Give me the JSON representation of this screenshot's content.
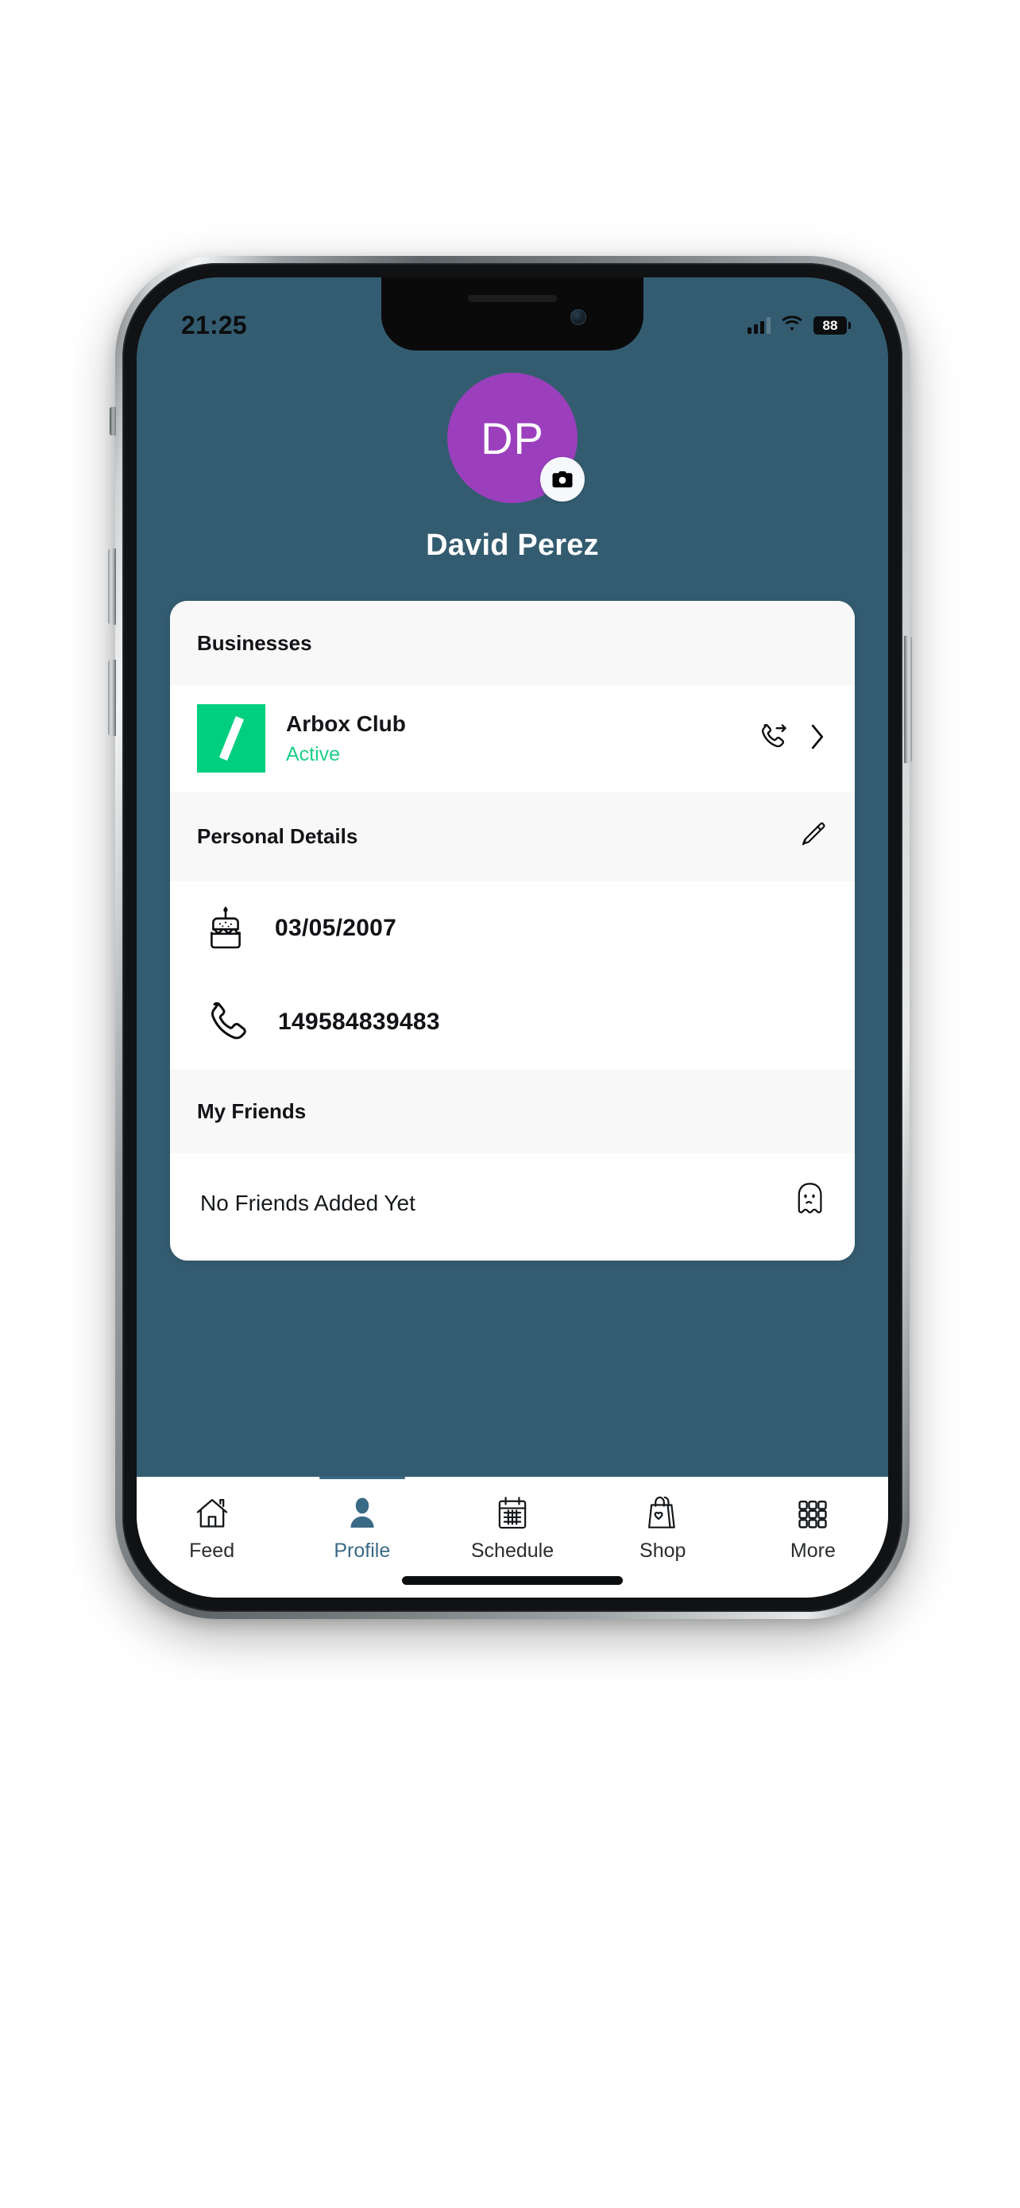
{
  "status_bar": {
    "time": "21:25",
    "battery_level": "88",
    "signal_icon": "cellular-signal-icon",
    "wifi_icon": "wifi-icon",
    "battery_icon": "battery-icon"
  },
  "profile": {
    "initials": "DP",
    "name": "David Perez",
    "avatar_color": "#9b3fbd",
    "camera_badge_icon": "camera-icon"
  },
  "card": {
    "businesses": {
      "title": "Businesses",
      "items": [
        {
          "name": "Arbox Club",
          "status": "Active",
          "status_color": "#1fd08a",
          "logo_color": "#00cf7f",
          "call_icon": "phone-forward-icon",
          "chevron_icon": "chevron-right-icon"
        }
      ]
    },
    "personal_details": {
      "title": "Personal Details",
      "edit_icon": "pencil-edit-icon",
      "rows": [
        {
          "icon": "birthday-cake-icon",
          "value": "03/05/2007"
        },
        {
          "icon": "phone-icon",
          "value": "149584839483"
        }
      ]
    },
    "my_friends": {
      "title": "My Friends",
      "empty_text": "No Friends Added Yet",
      "empty_icon": "ghost-icon"
    }
  },
  "tab_bar": {
    "active": "Profile",
    "active_color": "#3a6a86",
    "tabs": [
      {
        "label": "Feed",
        "icon": "home-icon"
      },
      {
        "label": "Profile",
        "icon": "person-icon"
      },
      {
        "label": "Schedule",
        "icon": "calendar-icon"
      },
      {
        "label": "Shop",
        "icon": "shopping-bag-heart-icon"
      },
      {
        "label": "More",
        "icon": "grid-menu-icon"
      }
    ]
  },
  "theme": {
    "app_background": "#345c70",
    "card_background": "#ffffff",
    "section_header_background": "#f8f8f8"
  }
}
